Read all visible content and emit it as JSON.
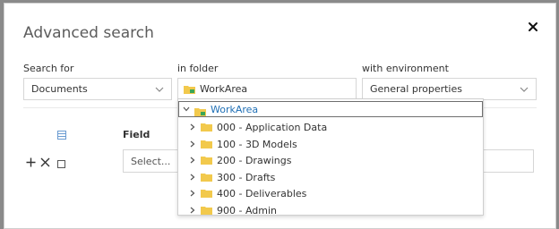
{
  "dialog": {
    "title": "Advanced search",
    "close_icon": "close-icon"
  },
  "search_for": {
    "label": "Search for",
    "value": "Documents"
  },
  "in_folder": {
    "label": "in folder",
    "value": "WorkArea"
  },
  "with_environment": {
    "label": "with environment",
    "value": "General properties"
  },
  "criteria": {
    "field_header": "Field",
    "field_placeholder": "Select..."
  },
  "folder_tree": {
    "root": "WorkArea",
    "items": [
      {
        "label": "000 - Application Data"
      },
      {
        "label": "100 - 3D Models"
      },
      {
        "label": "200 - Drawings"
      },
      {
        "label": "300 - Drafts"
      },
      {
        "label": "400 - Deliverables"
      },
      {
        "label": "900 - Admin"
      }
    ]
  },
  "colors": {
    "folder_yellow": "#f2c94c",
    "folder_green": "#3aa655",
    "root_text": "#1f6fb5"
  }
}
